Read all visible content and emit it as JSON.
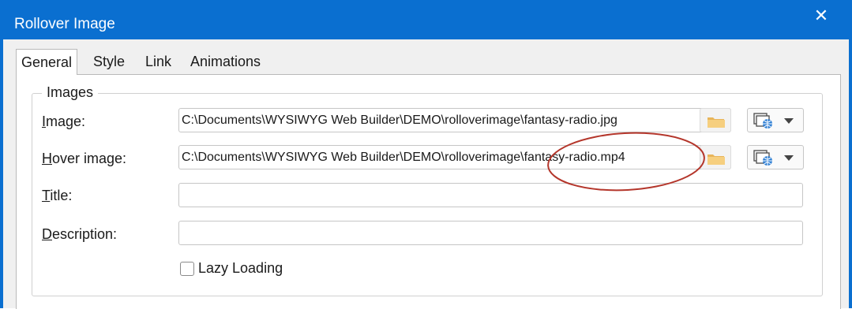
{
  "window": {
    "title": "Rollover Image",
    "close_glyph": "✕"
  },
  "tabs": [
    {
      "label": "General",
      "active": true
    },
    {
      "label": "Style",
      "active": false
    },
    {
      "label": "Link",
      "active": false
    },
    {
      "label": "Animations",
      "active": false
    }
  ],
  "images_group": {
    "legend": "Images",
    "image": {
      "label_mnemonic": "I",
      "label_rest": "mage:",
      "value": "C:\\Documents\\WYSIWYG Web Builder\\DEMO\\rolloverimage\\fantasy-radio.jpg"
    },
    "hover_image": {
      "label_mnemonic": "H",
      "label_rest": "over image:",
      "value": "C:\\Documents\\WYSIWYG Web Builder\\DEMO\\rolloverimage\\fantasy-radio.mp4"
    },
    "title": {
      "label_mnemonic": "T",
      "label_rest": "itle:",
      "value": ""
    },
    "description": {
      "label_mnemonic": "D",
      "label_rest": "escription:",
      "value": ""
    },
    "lazy_loading": {
      "label": "Lazy Loading",
      "checked": false
    }
  },
  "icons": {
    "browse": "folder-icon",
    "web": "web-image-icon",
    "dropdown": "dropdown-arrow-icon"
  },
  "colors": {
    "titlebar": "#0a6fd0",
    "annotation": "#b4362b",
    "folder": "#f2c36b"
  }
}
